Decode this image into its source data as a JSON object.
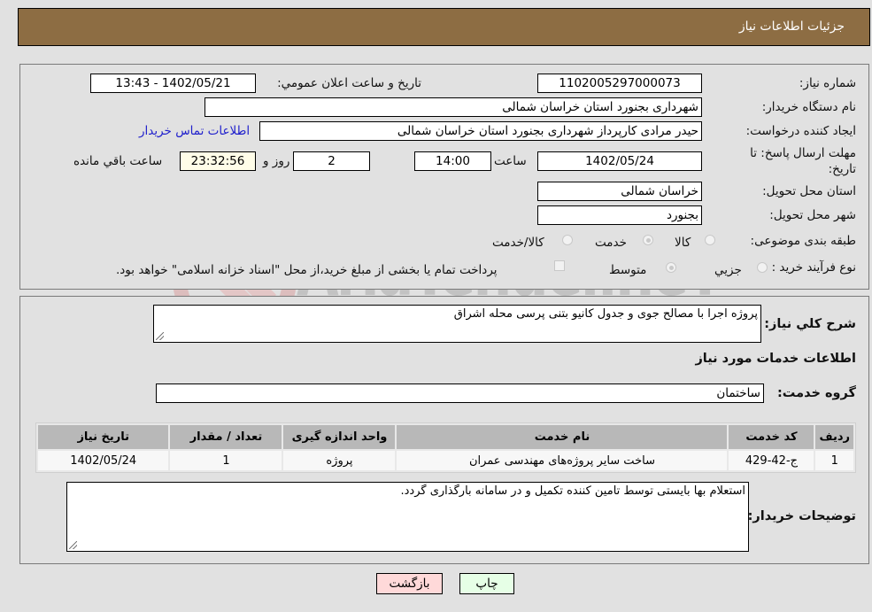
{
  "header": {
    "title": "جزئیات اطلاعات نیاز"
  },
  "fields": {
    "need_number_label": "شماره نیاز:",
    "need_number": "1102005297000073",
    "announce_label": "تاریخ و ساعت اعلان عمومي:",
    "announce_value": "1402/05/21 - 13:43",
    "buyer_org_label": "نام دستگاه خریدار:",
    "buyer_org": "شهرداری بجنورد استان خراسان شمالی",
    "requester_label": "ایجاد کننده درخواست:",
    "requester": "حیدر مرادی کارپرداز  شهرداری بجنورد استان خراسان شمالی",
    "buyer_contact_link": "اطلاعات تماس خریدار",
    "deadline_label": "مهلت ارسال پاسخ: تا تاریخ:",
    "deadline_date": "1402/05/24",
    "time_label": "ساعت",
    "deadline_time": "14:00",
    "days_value": "2",
    "days_label": "روز و",
    "remaining_time": "23:32:56",
    "remaining_label": "ساعت باقي مانده",
    "province_label": "استان محل تحویل:",
    "province": "خراسان شمالی",
    "city_label": "شهر محل تحویل:",
    "city": "بجنورد",
    "category_label": "طبقه بندی موضوعی:",
    "category_options": [
      {
        "label": "کالا",
        "selected": false
      },
      {
        "label": "خدمت",
        "selected": true
      },
      {
        "label": "کالا/خدمت",
        "selected": false
      }
    ],
    "process_label": "نوع فرآیند خرید :",
    "process_options": [
      {
        "label": "جزيي",
        "selected": false
      },
      {
        "label": "متوسط",
        "selected": true
      }
    ],
    "treasury_checkbox_label": "پرداخت تمام یا بخشی از مبلغ خرید،از محل \"اسناد خزانه اسلامی\" خواهد بود.",
    "treasury_checked": false
  },
  "details": {
    "summary_label": "شرح کلي نياز:",
    "summary": "پروژه اجرا با مصالح جوی و جدول کانیو بتنی پرسی محله اشراق",
    "services_heading": "اطلاعات خدمات مورد نياز",
    "service_group_label": "گروه خدمت:",
    "service_group": "ساختمان",
    "table": {
      "headers": [
        "ردیف",
        "کد خدمت",
        "نام خدمت",
        "واحد اندازه گیری",
        "تعداد / مقدار",
        "تاریخ نیاز"
      ],
      "rows": [
        [
          "1",
          "ج-42-429",
          "ساخت سایر پروژه‌های مهندسی عمران",
          "پروژه",
          "1",
          "1402/05/24"
        ]
      ]
    },
    "buyer_notes_label": "توضیحات خریدار:",
    "buyer_notes": "استعلام بها بایستی توسط تامین کننده تکمیل و در سامانه بارگذاری گردد."
  },
  "buttons": {
    "print": "چاپ",
    "back": "بازگشت"
  },
  "watermark": {
    "text": "AriaTender.neT"
  }
}
